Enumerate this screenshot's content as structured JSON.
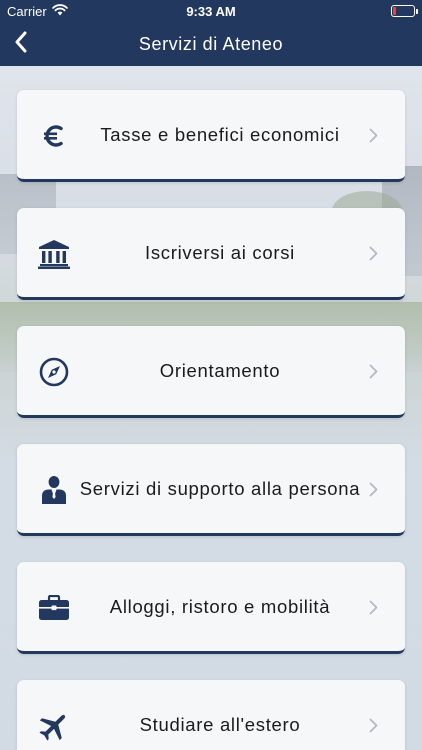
{
  "status_bar": {
    "carrier": "Carrier",
    "time": "9:33 AM",
    "battery_level_fraction": 0.15
  },
  "nav": {
    "title": "Servizi di Ateneo",
    "back_icon": "chevron-left-icon"
  },
  "colors": {
    "primary": "#23385e",
    "card_bg": "#f6f7f9",
    "chevron": "#b5b9c0",
    "battery_low": "#ff3b30"
  },
  "menu": {
    "items": [
      {
        "label": "Tasse e benefici economici",
        "icon": "euro-icon"
      },
      {
        "label": "Iscriversi ai corsi",
        "icon": "bank-building-icon"
      },
      {
        "label": "Orientamento",
        "icon": "compass-icon"
      },
      {
        "label": "Servizi di supporto alla persona",
        "icon": "person-suit-icon"
      },
      {
        "label": "Alloggi, ristoro e mobilità",
        "icon": "briefcase-icon"
      },
      {
        "label": "Studiare all'estero",
        "icon": "airplane-icon"
      }
    ]
  }
}
